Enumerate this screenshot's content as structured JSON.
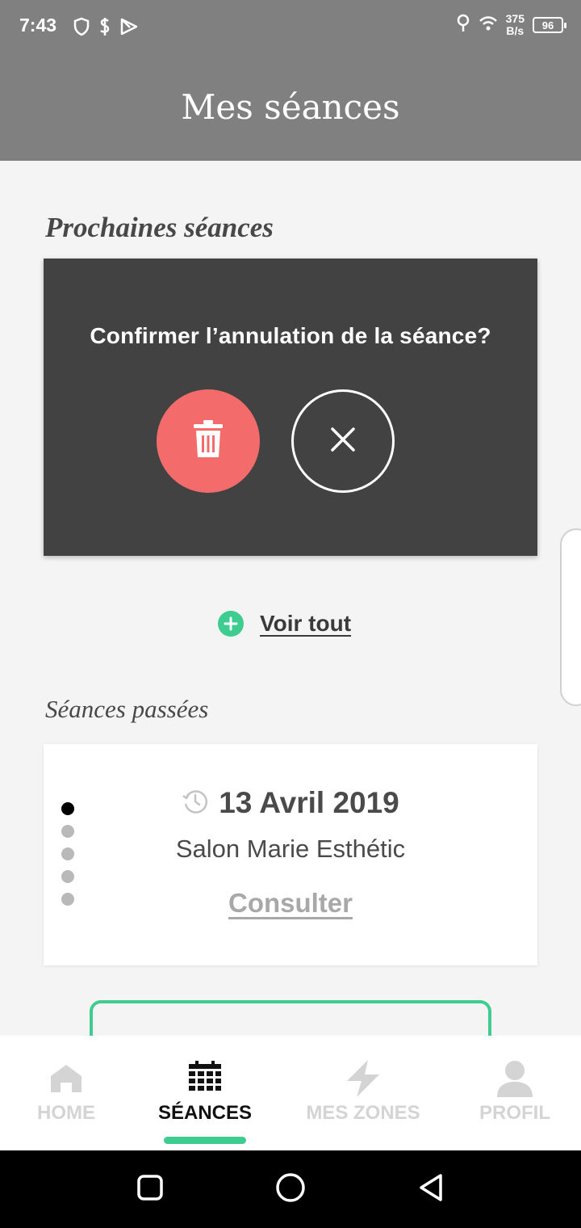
{
  "status_bar": {
    "time": "7:43",
    "net_speed_value": "375",
    "net_speed_unit": "B/s",
    "battery": "96"
  },
  "header": {
    "title": "Mes séances"
  },
  "upcoming": {
    "title": "Prochaines séances",
    "confirm_text": "Confirmer l’annulation de la séance?",
    "delete_icon": "trash-icon",
    "cancel_icon": "close-icon"
  },
  "see_all": {
    "label": "Voir tout"
  },
  "past": {
    "title": "Séances passées",
    "card": {
      "date": "13 Avril 2019",
      "salon": "Salon Marie Esthétic",
      "action": "Consulter",
      "active_dot": 1,
      "dot_count": 5
    }
  },
  "bottom_nav": {
    "items": [
      {
        "label": "HOME",
        "icon": "home-icon",
        "active": false
      },
      {
        "label": "SÉANCES",
        "icon": "calendar-icon",
        "active": true
      },
      {
        "label": "MES ZONES",
        "icon": "bolt-icon",
        "active": false
      },
      {
        "label": "PROFIL",
        "icon": "user-icon",
        "active": false
      }
    ]
  },
  "colors": {
    "header_bg": "#808080",
    "panel_bg": "#424242",
    "delete_red": "#f36b6b",
    "accent_green": "#3ecc91"
  }
}
